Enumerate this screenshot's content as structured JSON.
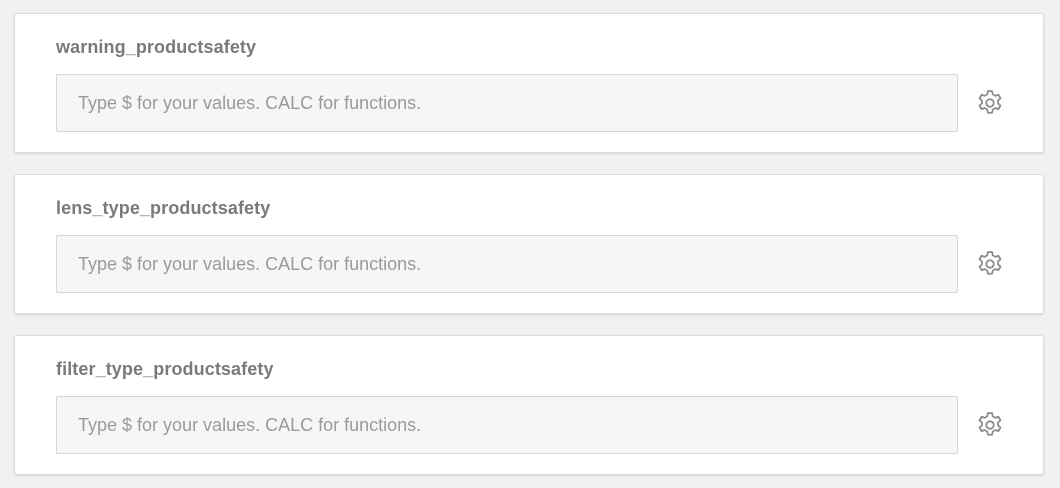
{
  "fields": [
    {
      "label": "warning_productsafety",
      "placeholder": "Type $ for your values. CALC for functions.",
      "value": ""
    },
    {
      "label": "lens_type_productsafety",
      "placeholder": "Type $ for your values. CALC for functions.",
      "value": ""
    },
    {
      "label": "filter_type_productsafety",
      "placeholder": "Type $ for your values. CALC for functions.",
      "value": ""
    }
  ],
  "icons": {
    "settings": "gear-icon"
  },
  "colors": {
    "background": "#f1f1f1",
    "card": "#ffffff",
    "label_text": "#7a7a7a",
    "placeholder_text": "#9a9a9a",
    "input_background": "#f6f6f6",
    "icon": "#8a8a8a"
  }
}
